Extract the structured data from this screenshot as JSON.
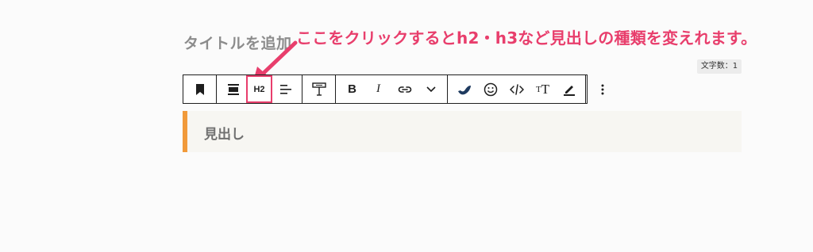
{
  "editor": {
    "title_placeholder": "タイトルを追加",
    "char_count": "文字数：1"
  },
  "annotation": {
    "text": "ここをクリックするとh2・h3など見出しの種類を変えれます。",
    "color": "#e83e6c"
  },
  "toolbar": {
    "h2_label": "H2",
    "bold_label": "B",
    "italic_label": "I",
    "icons": [
      "bookmark-icon",
      "align-block-icon",
      "heading-level-button",
      "align-text-icon",
      "column-layout-icon",
      "bold-icon",
      "italic-icon",
      "link-icon",
      "chevron-down-icon",
      "wave-icon",
      "emoji-icon",
      "code-icon",
      "typography-icon",
      "highlight-icon",
      "more-options-icon"
    ]
  },
  "block": {
    "heading_text": "見出し",
    "accent_color": "#f19a3a"
  }
}
